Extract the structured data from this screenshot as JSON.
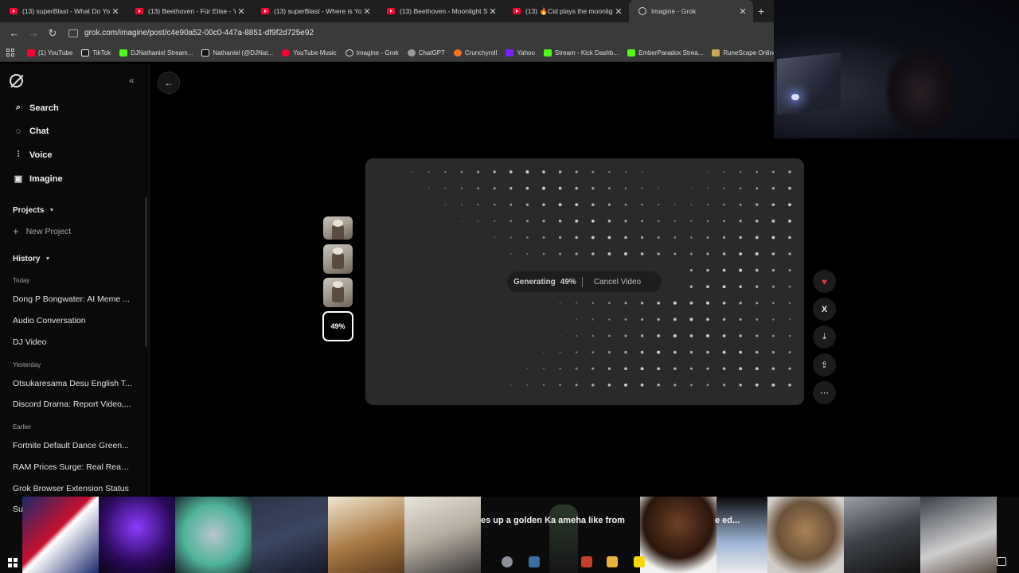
{
  "browser": {
    "tabs": [
      {
        "label": "(13) superBlast - What Do You Wa",
        "icon": "youtube-icon"
      },
      {
        "label": "(13) Beethoven - Für Elise - You",
        "icon": "youtube-icon"
      },
      {
        "label": "(13) superBlast - Where is Your",
        "icon": "youtube-icon"
      },
      {
        "label": "(13) Beethoven - Moonlight Sona",
        "icon": "youtube-icon"
      },
      {
        "label": "(13) 🔥Cid plays the moonlight",
        "icon": "youtube-icon"
      },
      {
        "label": "Imagine - Grok",
        "icon": "grok-icon",
        "active": true
      }
    ],
    "url": "grok.com/imagine/post/c4e90a52-00c0-447a-8851-df9f2d725e92",
    "bookmarks": [
      {
        "label": "(1) YouTube",
        "color": "#ff0033"
      },
      {
        "label": "TikTok",
        "color": "#ffffff"
      },
      {
        "label": "DJNathaniel Stream...",
        "color": "#53fc18"
      },
      {
        "label": "Nathaniel (@DJNat...",
        "color": "#e7e7e7"
      },
      {
        "label": "YouTube Music",
        "color": "#ff0033"
      },
      {
        "label": "Imagine - Grok",
        "color": "#dddddd"
      },
      {
        "label": "ChatGPT",
        "color": "#cfcfcf"
      },
      {
        "label": "Crunchyroll",
        "color": "#f47521"
      },
      {
        "label": "Yahoo",
        "color": "#7e1fff"
      },
      {
        "label": "Stream - Kick Dashb...",
        "color": "#53fc18"
      },
      {
        "label": "EmberParadox Strea...",
        "color": "#53fc18"
      },
      {
        "label": "RuneScape Online",
        "color": "#c6a458"
      }
    ]
  },
  "sidebar": {
    "nav": [
      {
        "label": "Search",
        "icon": "search-icon"
      },
      {
        "label": "Chat",
        "icon": "chat-icon"
      },
      {
        "label": "Voice",
        "icon": "voice-icon"
      },
      {
        "label": "Imagine",
        "icon": "imagine-icon"
      }
    ],
    "projects_label": "Projects",
    "new_project_label": "New Project",
    "history_label": "History",
    "groups": [
      {
        "label": "Today",
        "items": [
          "Dong P Bongwater: AI Meme ...",
          "Audio Conversation",
          "DJ Video"
        ]
      },
      {
        "label": "Yesterday",
        "items": [
          "Otsukaresama Desu English T...",
          "Discord Drama: Report Video,..."
        ]
      },
      {
        "label": "Earlier",
        "items": [
          "Fortnite Default Dance Green...",
          "RAM Prices Surge: Real Reaso...",
          "Grok Browser Extension Status"
        ]
      }
    ],
    "cut_item": "Su"
  },
  "main": {
    "current_thumb_label": "49%",
    "status_label": "Generating",
    "progress_text": "49%",
    "progress": 0.49,
    "cancel_label": "Cancel Video",
    "actions": [
      {
        "name": "favorite-button",
        "icon": "heart-icon",
        "glyph": "♥"
      },
      {
        "name": "share-x-button",
        "icon": "x-logo-icon",
        "glyph": "𝕏"
      },
      {
        "name": "download-button",
        "icon": "download-icon",
        "glyph": "⤓"
      },
      {
        "name": "upload-button",
        "icon": "share-icon",
        "glyph": "⇪"
      },
      {
        "name": "more-button",
        "icon": "more-icon",
        "glyph": "⋯"
      }
    ]
  },
  "overlay": {
    "caption": "es up a golden Ka   ameha like from",
    "caption2": "e ed..."
  }
}
